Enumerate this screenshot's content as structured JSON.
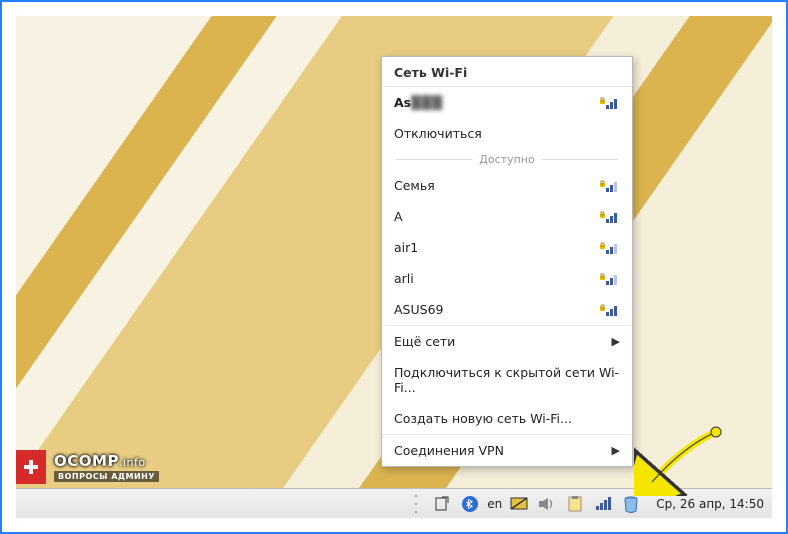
{
  "menu": {
    "title": "Сеть Wi-Fi",
    "connected": {
      "name": "As",
      "obscured": "███"
    },
    "disconnect": "Отключиться",
    "available_label": "Доступно",
    "networks": [
      {
        "name": "Семья"
      },
      {
        "name": "A"
      },
      {
        "name": "air1"
      },
      {
        "name": "arli"
      },
      {
        "name": "ASUS69"
      }
    ],
    "more_networks": "Ещё сети",
    "connect_hidden": "Подключиться к скрытой сети Wi-Fi...",
    "create_new": "Создать новую сеть Wi-Fi...",
    "vpn": "Соединения VPN"
  },
  "taskbar": {
    "lang": "en",
    "clock": "Ср, 26 апр, 14:50"
  },
  "brand": {
    "name": "OCOMP",
    "tld": ".info",
    "tagline": "ВОПРОСЫ АДМИНУ"
  }
}
